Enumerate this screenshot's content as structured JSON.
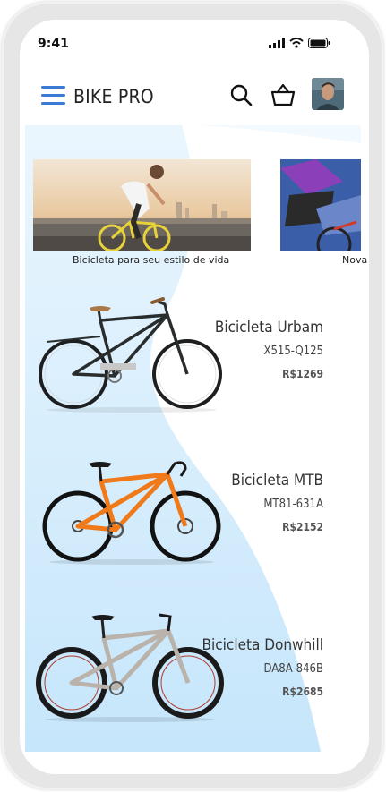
{
  "status_bar": {
    "time": "9:41"
  },
  "header": {
    "brand": "BIKE PRO",
    "menu_color": "#3a7bd5"
  },
  "colors": {
    "accent": "#2f80ed",
    "background_blue": "#cde9fb"
  },
  "banners": [
    {
      "caption": "Bicicleta para seu estilo de vida"
    },
    {
      "caption": "Nova"
    }
  ],
  "products": [
    {
      "name": "Bicicleta Urbam",
      "code": "X515-Q125",
      "price": "R$1269",
      "frame_color": "#2a2d2e"
    },
    {
      "name": "Bicicleta MTB",
      "code": "MT81-631A",
      "price": "R$2152",
      "frame_color": "#f07a1a"
    },
    {
      "name": "Bicicleta Donwhill",
      "code": "DA8A-846B",
      "price": "R$2685",
      "frame_color": "#b9b3ab"
    }
  ]
}
